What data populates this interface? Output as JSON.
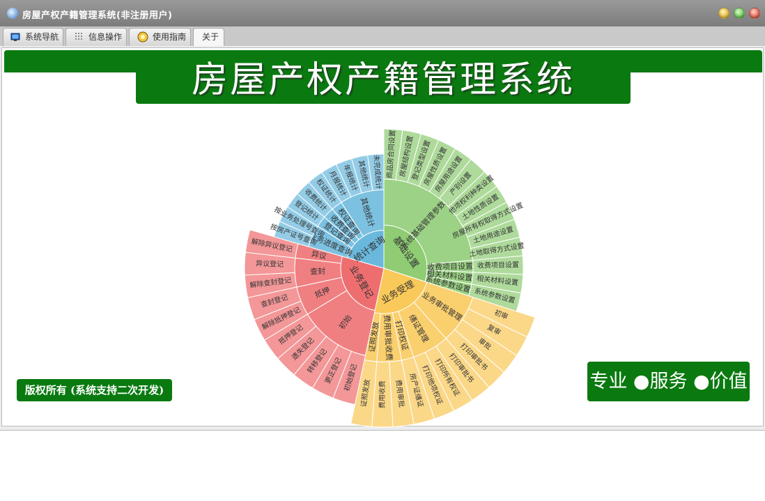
{
  "window": {
    "title": "房屋产权产籍管理系统(非注册用户)"
  },
  "tabs": [
    {
      "label": "系统导航",
      "icon": "monitor-icon"
    },
    {
      "label": "信息操作",
      "icon": "grid-icon"
    },
    {
      "label": "使用指南",
      "icon": "guide-icon"
    },
    {
      "label": "关于",
      "icon": ""
    }
  ],
  "banner": {
    "title": "房屋产权产籍管理系统"
  },
  "footer": {
    "copyright": "版权所有 (系统支持二次开发)",
    "motto": "专业 ●服务 ●价值"
  },
  "colors": {
    "brand_green": "#0a7a10",
    "green": "#8fcc74",
    "yellow": "#f9c95a",
    "red": "#ee6e70",
    "blue": "#6ab8dc"
  },
  "sunburst": {
    "center_label": "",
    "groups": [
      {
        "label": "基础设置",
        "color": "#8fcc74",
        "children": [
          {
            "label": "系统基础管理参数设置",
            "children": [
              "商品房合同设置",
              "房屋结构设置",
              "登记类型设置",
              "房屋性质设置",
              "房屋用途设置",
              "产别设置",
              "他项权利种类设置",
              "土地性质设置",
              "房屋所有权取得方式设置",
              "土地用途设置",
              "土地取得方式设置"
            ]
          },
          {
            "label": "收费项目设置",
            "children": [
              "收费项目设置"
            ]
          },
          {
            "label": "相关材料设置",
            "children": [
              "相关材料设置"
            ]
          },
          {
            "label": "系统参数设置",
            "children": [
              "系统参数设置"
            ]
          }
        ]
      },
      {
        "label": "业务受理",
        "color": "#f9c95a",
        "children": [
          {
            "label": "业务审批管理",
            "children": [
              "初审",
              "复审",
              "审批",
              "打印审批书"
            ]
          },
          {
            "label": "缮证管理",
            "children": [
              "打印审批书",
              "打印所有权证",
              "打印他项权证"
            ]
          },
          {
            "label": "打印权证",
            "children": [
              "房产证缮证"
            ]
          },
          {
            "label": "费用审批收费",
            "children": [
              "费用审批",
              "费用收费"
            ]
          },
          {
            "label": "证照发放",
            "children": [
              "证照发放"
            ]
          }
        ]
      },
      {
        "label": "业务登记",
        "color": "#ee6e70",
        "children": [
          {
            "label": "初始",
            "children": [
              "初始登记",
              "更正登记",
              "转移登记",
              "遗失登记",
              "抵押登记"
            ]
          },
          {
            "label": "抵押",
            "children": [
              "解除抵押登记",
              "查封登记"
            ]
          },
          {
            "label": "查封",
            "children": [
              "解除查封登记",
              "异议登记"
            ]
          },
          {
            "label": "异议",
            "children": [
              "解除异议登记"
            ]
          }
        ]
      },
      {
        "label": "统计查询",
        "color": "#6ab8dc",
        "children": [
          {
            "label": "业务进度查询",
            "children": [
              "按房产证号查询",
              "按业务处理号查询"
            ]
          },
          {
            "label": "登记查询",
            "children": [
              "登记统计"
            ]
          },
          {
            "label": "收费查询",
            "children": [
              "收费统计"
            ]
          },
          {
            "label": "权证查询",
            "children": [
              "权证统计"
            ]
          },
          {
            "label": "其他统计",
            "children": [
              "月报统计",
              "年报统计",
              "其他统计",
              "未完成统计"
            ]
          }
        ]
      }
    ]
  }
}
